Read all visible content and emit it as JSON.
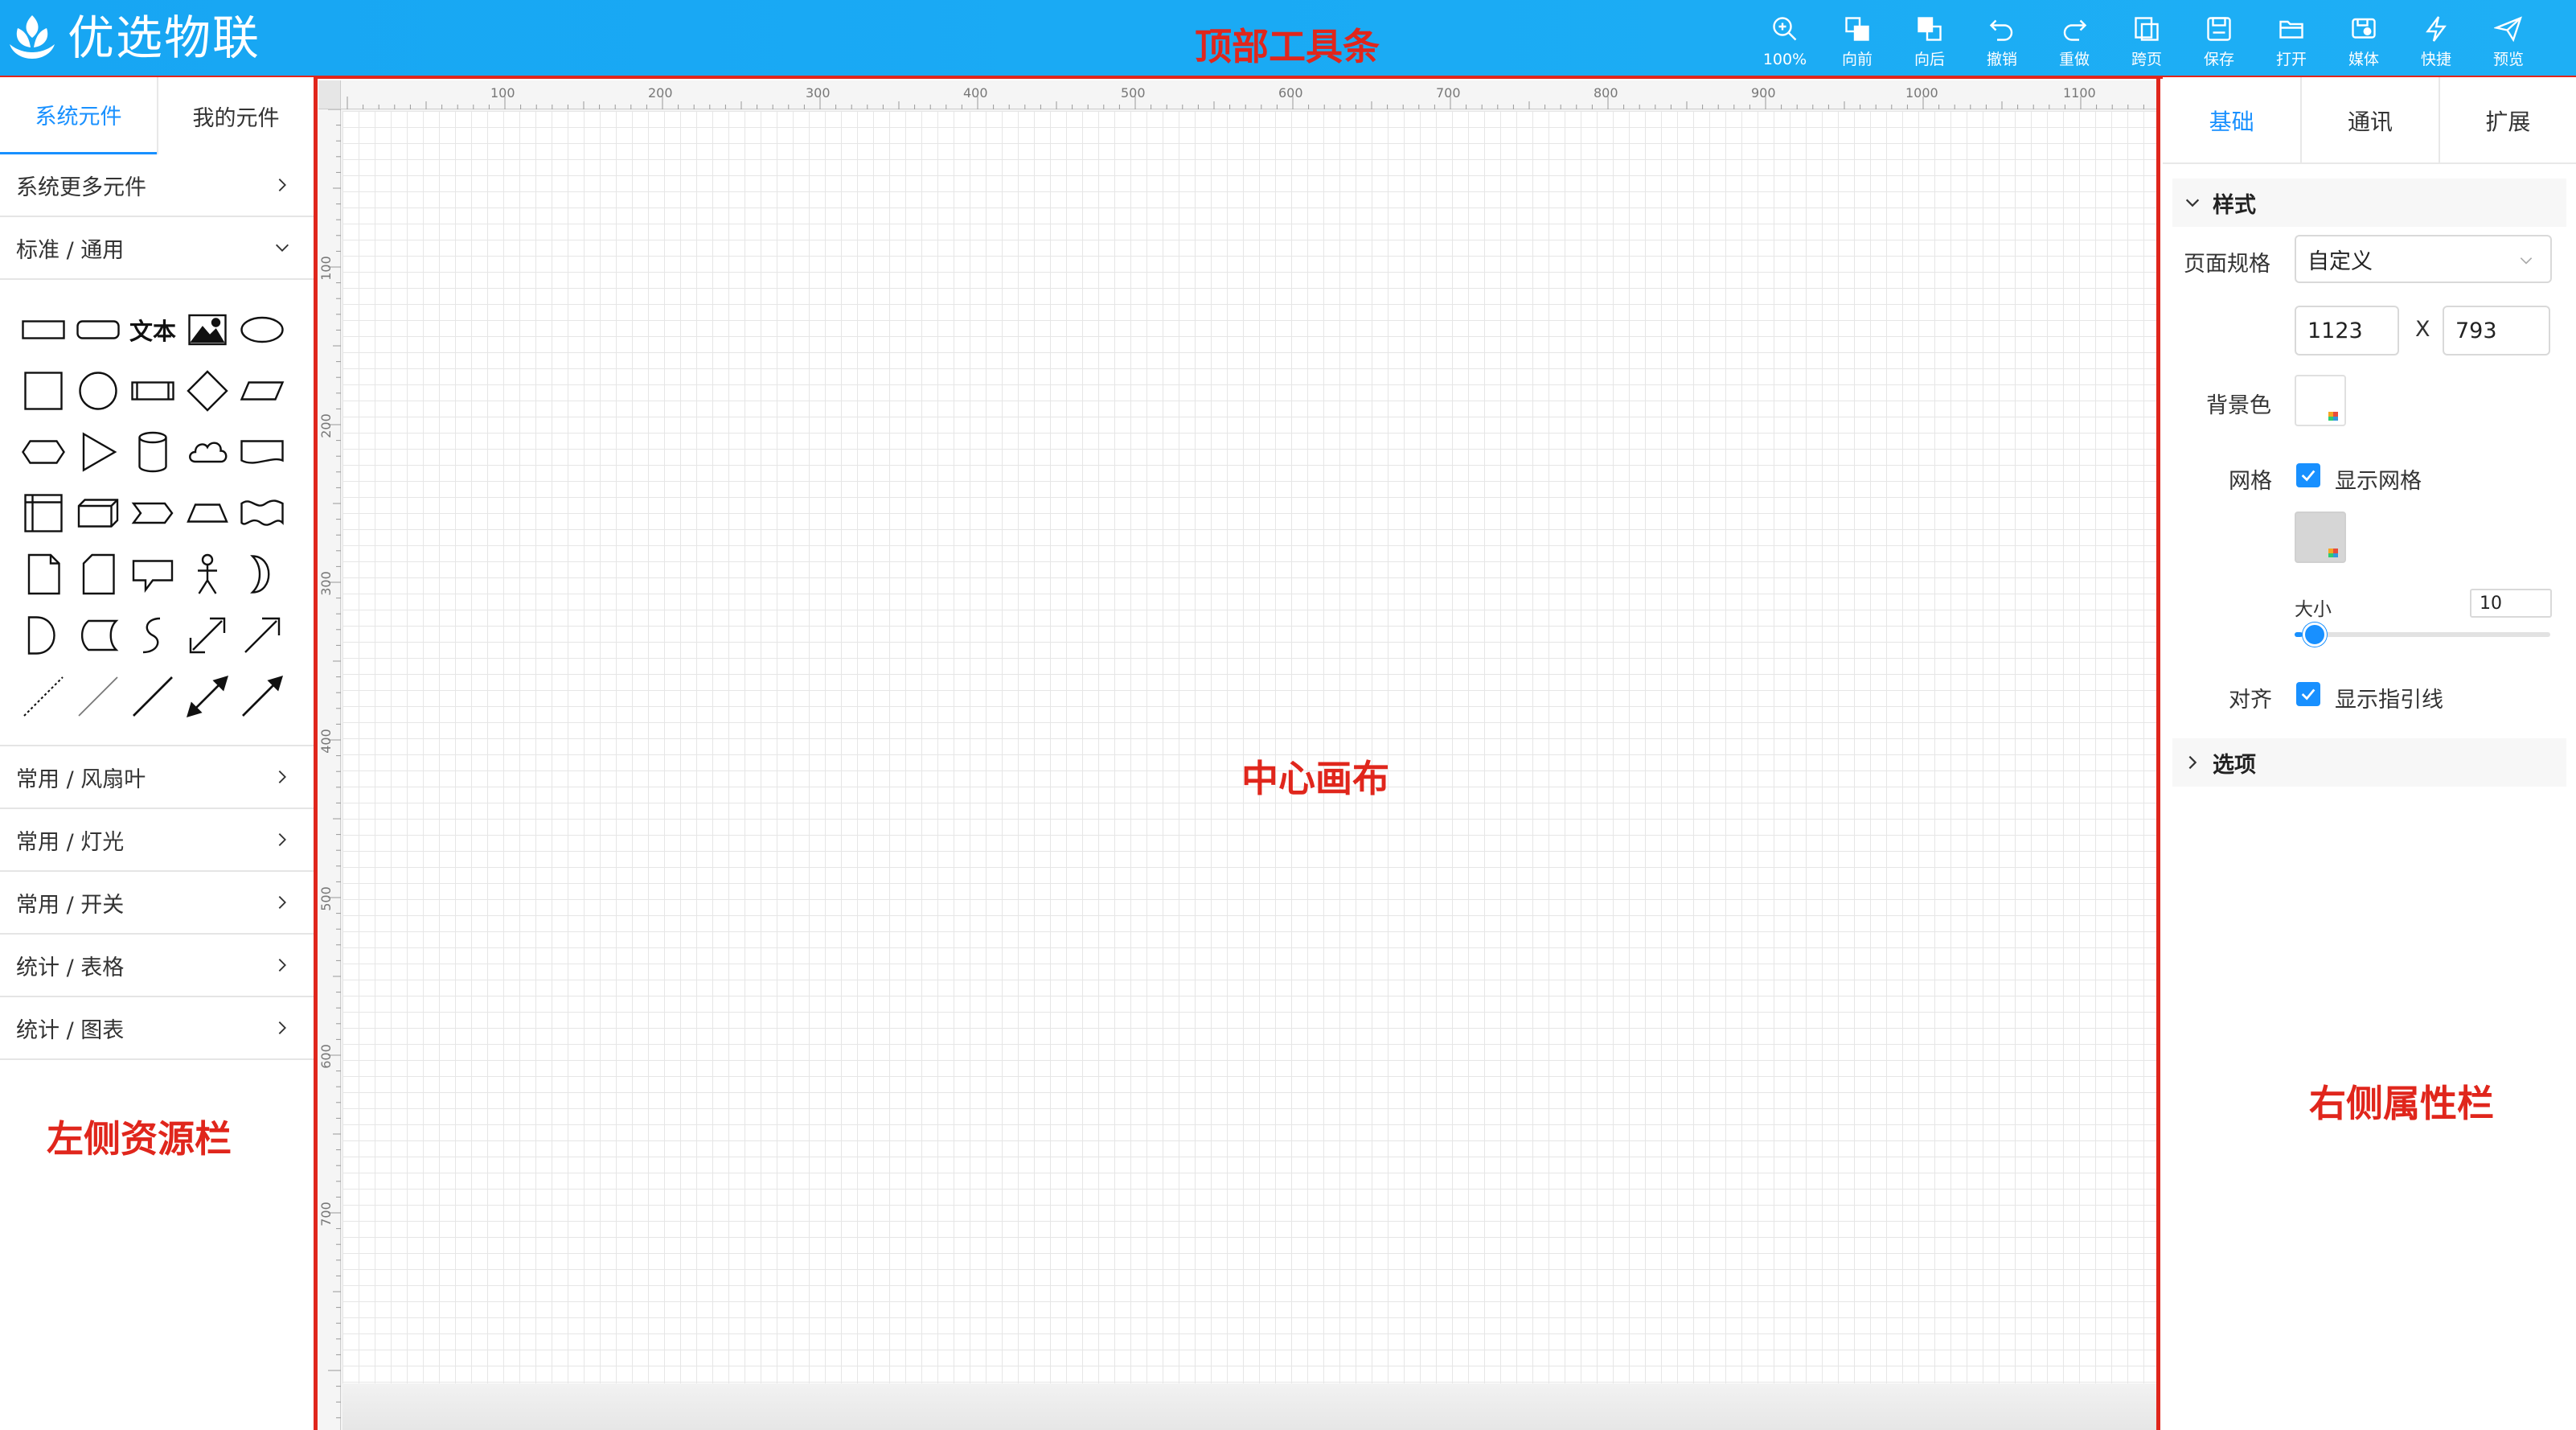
{
  "app": {
    "title": "优选物联"
  },
  "toolbar": {
    "items": [
      {
        "label": "100%",
        "icon": "zoom-icon"
      },
      {
        "label": "向前",
        "icon": "bring-forward-icon"
      },
      {
        "label": "向后",
        "icon": "send-backward-icon"
      },
      {
        "label": "撤销",
        "icon": "undo-icon"
      },
      {
        "label": "重做",
        "icon": "redo-icon"
      },
      {
        "label": "跨页",
        "icon": "cross-page-icon"
      },
      {
        "label": "保存",
        "icon": "save-icon"
      },
      {
        "label": "打开",
        "icon": "open-folder-icon"
      },
      {
        "label": "媒体",
        "icon": "media-icon"
      },
      {
        "label": "快捷",
        "icon": "lightning-icon"
      },
      {
        "label": "预览",
        "icon": "send-icon"
      }
    ]
  },
  "annotations": {
    "top": "顶部工具条",
    "center": "中心画布",
    "left": "左侧资源栏",
    "right": "右侧属性栏"
  },
  "left": {
    "tabs": [
      "系统元件",
      "我的元件"
    ],
    "groups_top": [
      "系统更多元件",
      "标准 / 通用"
    ],
    "text_shape": "文本",
    "groups_bottom": [
      "常用 / 风扇叶",
      "常用 / 灯光",
      "常用 / 开关",
      "统计 / 表格",
      "统计 / 图表"
    ]
  },
  "canvas": {
    "ruler_top": [
      "100",
      "200",
      "300",
      "400",
      "500",
      "600",
      "700",
      "800",
      "900",
      "1000",
      "1100"
    ],
    "ruler_left": [
      "100",
      "200",
      "300",
      "400",
      "500",
      "600",
      "700"
    ]
  },
  "right": {
    "tabs": [
      "基础",
      "通讯",
      "扩展"
    ],
    "style_section": "样式",
    "page_spec_label": "页面规格",
    "page_spec_value": "自定义",
    "width": "1123",
    "x_label": "X",
    "height": "793",
    "bg_label": "背景色",
    "grid_label": "网格",
    "show_grid": "显示网格",
    "size_label": "大小",
    "size_value": "10",
    "size_level": 0.03,
    "align_label": "对齐",
    "show_guides": "显示指引线",
    "options_section": "选项"
  },
  "colors": {
    "accent": "#1890ff",
    "topbar": "#1aa9f4",
    "annotation": "#e0261c"
  }
}
